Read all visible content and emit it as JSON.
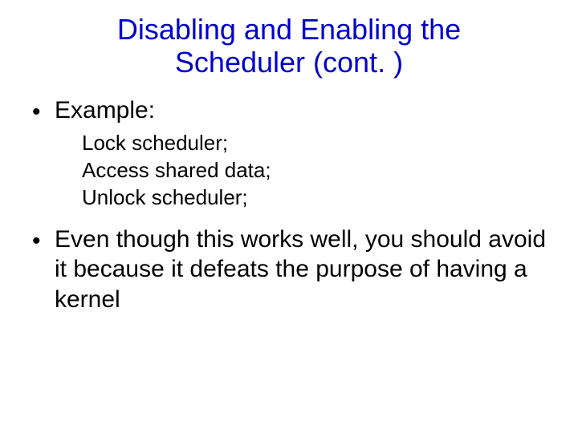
{
  "slide": {
    "title": "Disabling and Enabling the Scheduler (cont. )",
    "bullet1": "Example:",
    "sub1": "Lock scheduler;",
    "sub2": "Access shared data;",
    "sub3": "Unlock scheduler;",
    "bullet2": "Even though this works well, you should avoid it because it defeats the purpose of having a kernel",
    "dot": "•"
  }
}
